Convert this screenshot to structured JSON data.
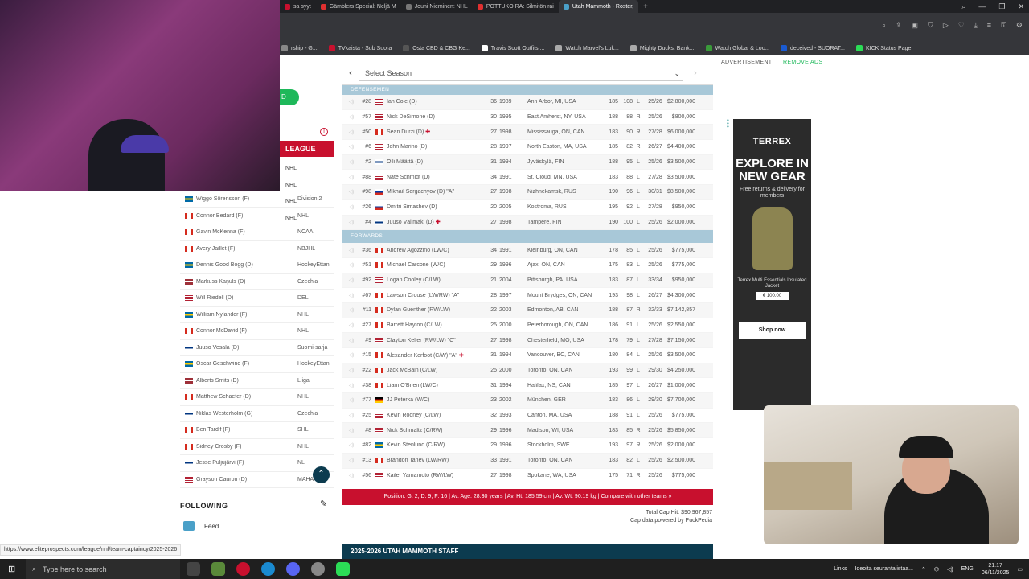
{
  "browser": {
    "tabs": [
      {
        "label": "sa syyt",
        "color": "#c8102e"
      },
      {
        "label": "Gämblers Special: Neljä M",
        "color": "#e03030"
      },
      {
        "label": "Jouni Nieminen: NHL",
        "color": "#777777"
      },
      {
        "label": "POTTUKOIRA: Silmitön rai",
        "color": "#e03030"
      },
      {
        "label": "Utah Mammoth - Roster,",
        "color": "#4aa0c8",
        "active": true
      }
    ],
    "new_tab": "+",
    "bookmarks": [
      "rship - G...",
      "TVkaista - Sub Suora",
      "Osta CBD & CBG Ke...",
      "Travis Scott Outfits,...",
      "Watch Marvel's Luk...",
      "Mighty Ducks: Bank...",
      "Watch Global & Loc...",
      "deceived - SUORAT...",
      "KICK Status Page"
    ]
  },
  "sidebar": {
    "top_pill": "D",
    "league_header": "LEAGUE",
    "top_leagues": [
      "NHL",
      "NHL",
      "NHL",
      "NHL"
    ],
    "players": [
      {
        "name": "Wiggo Sörensson (F)",
        "league": "Division 2",
        "flag": "se"
      },
      {
        "name": "Connor Bedard (F)",
        "league": "NHL",
        "flag": "ca"
      },
      {
        "name": "Gavin McKenna (F)",
        "league": "NCAA",
        "flag": "ca"
      },
      {
        "name": "Avery Jaillet (F)",
        "league": "NBJHL",
        "flag": "ca"
      },
      {
        "name": "Dennis Good Bogg (D)",
        "league": "HockeyEttan",
        "flag": "se"
      },
      {
        "name": "Markuss Kaņuls (D)",
        "league": "Czechia",
        "flag": "lv"
      },
      {
        "name": "Will Riedell (D)",
        "league": "DEL",
        "flag": "us"
      },
      {
        "name": "William Nylander (F)",
        "league": "NHL",
        "flag": "se"
      },
      {
        "name": "Connor McDavid (F)",
        "league": "NHL",
        "flag": "ca"
      },
      {
        "name": "Juuso Vesala (D)",
        "league": "Suomi-sarja",
        "flag": "fi"
      },
      {
        "name": "Oscar Geschwind (F)",
        "league": "HockeyEttan",
        "flag": "se"
      },
      {
        "name": "Alberts Šmits (D)",
        "league": "Liiga",
        "flag": "lv"
      },
      {
        "name": "Matthew Schaefer (D)",
        "league": "NHL",
        "flag": "ca"
      },
      {
        "name": "Niklas Westerholm (G)",
        "league": "Czechia",
        "flag": "fi"
      },
      {
        "name": "Ben Tardif (F)",
        "league": "SHL",
        "flag": "ca"
      },
      {
        "name": "Sidney Crosby (F)",
        "league": "NHL",
        "flag": "ca"
      },
      {
        "name": "Jesse Puljujärvi (F)",
        "league": "NL",
        "flag": "fi"
      },
      {
        "name": "Grayson Cauron (D)",
        "league": "MAHA 14U",
        "flag": "us"
      }
    ],
    "following_label": "FOLLOWING",
    "feed_label": "Feed",
    "status_url": "https://www.eliteprospects.com/league/nhl/team-captaincy/2025-2026"
  },
  "roster": {
    "season_placeholder": "Select Season",
    "defensemen_label": "DEFENSEMEN",
    "forwards_label": "FORWARDS",
    "defensemen": [
      {
        "num": "#28",
        "name": "Ian Cole (D)",
        "plus": false,
        "age": "36",
        "born": "1989",
        "place": "Ann Arbor, MI, USA",
        "h": "185",
        "w": "108",
        "s": "L",
        "c": "25/26",
        "cap": "$2,800,000",
        "flag": "us"
      },
      {
        "num": "#57",
        "name": "Nick DeSimone (D)",
        "plus": false,
        "age": "30",
        "born": "1995",
        "place": "East Amherst, NY, USA",
        "h": "188",
        "w": "88",
        "s": "R",
        "c": "25/26",
        "cap": "$800,000",
        "flag": "us"
      },
      {
        "num": "#50",
        "name": "Sean Durzi (D)",
        "plus": true,
        "age": "27",
        "born": "1998",
        "place": "Mississauga, ON, CAN",
        "h": "183",
        "w": "90",
        "s": "R",
        "c": "27/28",
        "cap": "$6,000,000",
        "flag": "ca"
      },
      {
        "num": "#6",
        "name": "John Marino (D)",
        "plus": false,
        "age": "28",
        "born": "1997",
        "place": "North Easton, MA, USA",
        "h": "185",
        "w": "82",
        "s": "R",
        "c": "26/27",
        "cap": "$4,400,000",
        "flag": "us"
      },
      {
        "num": "#2",
        "name": "Olli Määttä (D)",
        "plus": false,
        "age": "31",
        "born": "1994",
        "place": "Jyväskylä, FIN",
        "h": "188",
        "w": "95",
        "s": "L",
        "c": "25/26",
        "cap": "$3,500,000",
        "flag": "fi"
      },
      {
        "num": "#88",
        "name": "Nate Schmidt (D)",
        "plus": false,
        "age": "34",
        "born": "1991",
        "place": "St. Cloud, MN, USA",
        "h": "183",
        "w": "88",
        "s": "L",
        "c": "27/28",
        "cap": "$3,500,000",
        "flag": "us"
      },
      {
        "num": "#98",
        "name": "Mikhail Sergachyov (D) \"A\"",
        "plus": false,
        "age": "27",
        "born": "1998",
        "place": "Nizhnekamsk, RUS",
        "h": "190",
        "w": "96",
        "s": "L",
        "c": "30/31",
        "cap": "$8,500,000",
        "flag": "ru"
      },
      {
        "num": "#26",
        "name": "Dmitri Simashev (D)",
        "plus": false,
        "age": "20",
        "born": "2005",
        "place": "Kostroma, RUS",
        "h": "195",
        "w": "92",
        "s": "L",
        "c": "27/28",
        "cap": "$950,000",
        "flag": "ru"
      },
      {
        "num": "#4",
        "name": "Juuso Välimäki (D)",
        "plus": true,
        "age": "27",
        "born": "1998",
        "place": "Tampere, FIN",
        "h": "190",
        "w": "100",
        "s": "L",
        "c": "25/26",
        "cap": "$2,000,000",
        "flag": "fi"
      }
    ],
    "forwards": [
      {
        "num": "#36",
        "name": "Andrew Agozzino (LW/C)",
        "plus": false,
        "age": "34",
        "born": "1991",
        "place": "Kleinburg, ON, CAN",
        "h": "178",
        "w": "85",
        "s": "L",
        "c": "25/26",
        "cap": "$775,000",
        "flag": "ca"
      },
      {
        "num": "#51",
        "name": "Michael Carcone (W/C)",
        "plus": false,
        "age": "29",
        "born": "1996",
        "place": "Ajax, ON, CAN",
        "h": "175",
        "w": "83",
        "s": "L",
        "c": "25/26",
        "cap": "$775,000",
        "flag": "ca"
      },
      {
        "num": "#92",
        "name": "Logan Cooley (C/LW)",
        "plus": false,
        "age": "21",
        "born": "2004",
        "place": "Pittsburgh, PA, USA",
        "h": "183",
        "w": "87",
        "s": "L",
        "c": "33/34",
        "cap": "$950,000",
        "flag": "us"
      },
      {
        "num": "#67",
        "name": "Lawson Crouse (LW/RW) \"A\"",
        "plus": false,
        "age": "28",
        "born": "1997",
        "place": "Mount Brydges, ON, CAN",
        "h": "193",
        "w": "98",
        "s": "L",
        "c": "26/27",
        "cap": "$4,300,000",
        "flag": "ca"
      },
      {
        "num": "#11",
        "name": "Dylan Guenther (RW/LW)",
        "plus": false,
        "age": "22",
        "born": "2003",
        "place": "Edmonton, AB, CAN",
        "h": "188",
        "w": "87",
        "s": "R",
        "c": "32/33",
        "cap": "$7,142,857",
        "flag": "ca"
      },
      {
        "num": "#27",
        "name": "Barrett Hayton (C/LW)",
        "plus": false,
        "age": "25",
        "born": "2000",
        "place": "Peterborough, ON, CAN",
        "h": "186",
        "w": "91",
        "s": "L",
        "c": "25/26",
        "cap": "$2,550,000",
        "flag": "ca"
      },
      {
        "num": "#9",
        "name": "Clayton Keller (RW/LW) \"C\"",
        "plus": false,
        "age": "27",
        "born": "1998",
        "place": "Chesterfield, MO, USA",
        "h": "178",
        "w": "79",
        "s": "L",
        "c": "27/28",
        "cap": "$7,150,000",
        "flag": "us"
      },
      {
        "num": "#15",
        "name": "Alexander Kerfoot (C/W) \"A\"",
        "plus": true,
        "age": "31",
        "born": "1994",
        "place": "Vancouver, BC, CAN",
        "h": "180",
        "w": "84",
        "s": "L",
        "c": "25/26",
        "cap": "$3,500,000",
        "flag": "ca"
      },
      {
        "num": "#22",
        "name": "Jack McBain (C/LW)",
        "plus": false,
        "age": "25",
        "born": "2000",
        "place": "Toronto, ON, CAN",
        "h": "193",
        "w": "99",
        "s": "L",
        "c": "29/30",
        "cap": "$4,250,000",
        "flag": "ca"
      },
      {
        "num": "#38",
        "name": "Liam O'Brien (LW/C)",
        "plus": false,
        "age": "31",
        "born": "1994",
        "place": "Halifax, NS, CAN",
        "h": "185",
        "w": "97",
        "s": "L",
        "c": "26/27",
        "cap": "$1,000,000",
        "flag": "ca"
      },
      {
        "num": "#77",
        "name": "JJ Peterka (W/C)",
        "plus": false,
        "age": "23",
        "born": "2002",
        "place": "München, GER",
        "h": "183",
        "w": "86",
        "s": "L",
        "c": "29/30",
        "cap": "$7,700,000",
        "flag": "de"
      },
      {
        "num": "#25",
        "name": "Kevin Rooney (C/LW)",
        "plus": false,
        "age": "32",
        "born": "1993",
        "place": "Canton, MA, USA",
        "h": "188",
        "w": "91",
        "s": "L",
        "c": "25/26",
        "cap": "$775,000",
        "flag": "us"
      },
      {
        "num": "#8",
        "name": "Nick Schmaltz (C/RW)",
        "plus": false,
        "age": "29",
        "born": "1996",
        "place": "Madison, WI, USA",
        "h": "183",
        "w": "85",
        "s": "R",
        "c": "25/26",
        "cap": "$5,850,000",
        "flag": "us"
      },
      {
        "num": "#82",
        "name": "Kevin Stenlund (C/RW)",
        "plus": false,
        "age": "29",
        "born": "1996",
        "place": "Stockholm, SWE",
        "h": "193",
        "w": "97",
        "s": "R",
        "c": "25/26",
        "cap": "$2,000,000",
        "flag": "se"
      },
      {
        "num": "#13",
        "name": "Brandon Tanev (LW/RW)",
        "plus": false,
        "age": "33",
        "born": "1991",
        "place": "Toronto, ON, CAN",
        "h": "183",
        "w": "82",
        "s": "L",
        "c": "25/26",
        "cap": "$2,500,000",
        "flag": "ca"
      },
      {
        "num": "#56",
        "name": "Kailer Yamamoto (RW/LW)",
        "plus": false,
        "age": "27",
        "born": "1998",
        "place": "Spokane, WA, USA",
        "h": "175",
        "w": "71",
        "s": "R",
        "c": "25/26",
        "cap": "$775,000",
        "flag": "us"
      }
    ],
    "summary": "Position: G: 2, D: 9, F: 16  |  Av. Age: 28.30 years  |  Av. Ht: 185.59 cm  |  Av. Wt: 90.19 kg  |  Compare with other teams »",
    "cap_hit": "Total Cap Hit: $90,967,857",
    "cap_source": "Cap data powered by PuckPedia",
    "staff_title": "2025-2026 UTAH MAMMOTH STAFF"
  },
  "ad": {
    "label": "ADVERTISEMENT",
    "remove": "REMOVE ADS",
    "brand": "TERREX",
    "headline": "EXPLORE IN NEW GEAR",
    "sub": "Free returns & delivery for members",
    "product": "Terrex Multi Essentials Insulated Jacket",
    "price": "€ 100.00",
    "cta": "Shop now"
  },
  "taskbar": {
    "search_placeholder": "Type here to search",
    "links": "Links",
    "news": "Ideoita seurantalistaa...",
    "lang": "ENG",
    "time": "21.17",
    "date": "06/11/2025"
  },
  "flags": {
    "us": "linear-gradient(#b22234 0 14%,#fff 14% 28%,#b22234 28% 42%,#fff 42% 57%,#b22234 57% 71%,#fff 71% 85%,#b22234 85%)",
    "ca": "linear-gradient(90deg,#d52b1e 0 28%,#fff 28% 72%,#d52b1e 72%)",
    "fi": "linear-gradient(#fff 0 38%,#003580 38% 62%,#fff 62%)",
    "se": "linear-gradient(#006aa7 0 38%,#fecc00 38% 62%,#006aa7 62%)",
    "ru": "linear-gradient(#fff 0 33%,#0039a6 33% 66%,#d52b1e 66%)",
    "lv": "linear-gradient(#9e3039 0 40%,#fff 40% 60%,#9e3039 60%)",
    "de": "linear-gradient(#000 0 33%,#dd0000 33% 66%,#ffce00 66%)"
  }
}
